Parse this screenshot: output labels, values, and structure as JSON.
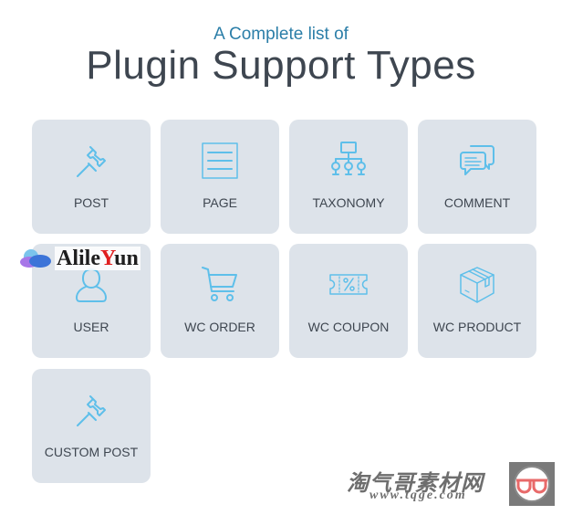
{
  "header": {
    "subtitle": "A Complete list of",
    "title": "Plugin Support Types"
  },
  "colors": {
    "accent": "#5ebfea",
    "subtitle": "#2b7ea8",
    "title": "#3e4650",
    "card_bg": "#dde3ea"
  },
  "cards": [
    {
      "label": "POST",
      "icon": "pushpin-icon"
    },
    {
      "label": "PAGE",
      "icon": "page-icon"
    },
    {
      "label": "TAXONOMY",
      "icon": "hierarchy-icon"
    },
    {
      "label": "COMMENT",
      "icon": "chat-bubbles-icon"
    },
    {
      "label": "USER",
      "icon": "user-icon"
    },
    {
      "label": "WC ORDER",
      "icon": "shopping-cart-icon"
    },
    {
      "label": "WC COUPON",
      "icon": "coupon-icon"
    },
    {
      "label": "WC PRODUCT",
      "icon": "box-icon"
    },
    {
      "label": "CUSTOM POST",
      "icon": "pushpin-icon"
    }
  ],
  "watermarks": {
    "aliyun": {
      "prefix": "Alile",
      "highlight": "Y",
      "suffix": "un"
    },
    "tqge": {
      "name": "淘气哥素材网",
      "url": "www.tqge.com"
    }
  }
}
